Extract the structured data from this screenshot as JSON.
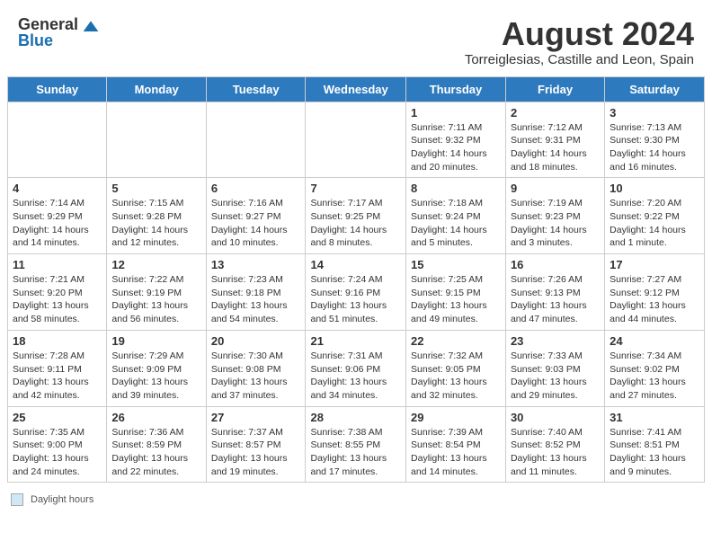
{
  "header": {
    "logo_general": "General",
    "logo_blue": "Blue",
    "month_year": "August 2024",
    "location": "Torreiglesias, Castille and Leon, Spain"
  },
  "weekdays": [
    "Sunday",
    "Monday",
    "Tuesday",
    "Wednesday",
    "Thursday",
    "Friday",
    "Saturday"
  ],
  "footer": {
    "label": "Daylight hours"
  },
  "weeks": [
    [
      {
        "day": "",
        "info": ""
      },
      {
        "day": "",
        "info": ""
      },
      {
        "day": "",
        "info": ""
      },
      {
        "day": "",
        "info": ""
      },
      {
        "day": "1",
        "info": "Sunrise: 7:11 AM\nSunset: 9:32 PM\nDaylight: 14 hours\nand 20 minutes."
      },
      {
        "day": "2",
        "info": "Sunrise: 7:12 AM\nSunset: 9:31 PM\nDaylight: 14 hours\nand 18 minutes."
      },
      {
        "day": "3",
        "info": "Sunrise: 7:13 AM\nSunset: 9:30 PM\nDaylight: 14 hours\nand 16 minutes."
      }
    ],
    [
      {
        "day": "4",
        "info": "Sunrise: 7:14 AM\nSunset: 9:29 PM\nDaylight: 14 hours\nand 14 minutes."
      },
      {
        "day": "5",
        "info": "Sunrise: 7:15 AM\nSunset: 9:28 PM\nDaylight: 14 hours\nand 12 minutes."
      },
      {
        "day": "6",
        "info": "Sunrise: 7:16 AM\nSunset: 9:27 PM\nDaylight: 14 hours\nand 10 minutes."
      },
      {
        "day": "7",
        "info": "Sunrise: 7:17 AM\nSunset: 9:25 PM\nDaylight: 14 hours\nand 8 minutes."
      },
      {
        "day": "8",
        "info": "Sunrise: 7:18 AM\nSunset: 9:24 PM\nDaylight: 14 hours\nand 5 minutes."
      },
      {
        "day": "9",
        "info": "Sunrise: 7:19 AM\nSunset: 9:23 PM\nDaylight: 14 hours\nand 3 minutes."
      },
      {
        "day": "10",
        "info": "Sunrise: 7:20 AM\nSunset: 9:22 PM\nDaylight: 14 hours\nand 1 minute."
      }
    ],
    [
      {
        "day": "11",
        "info": "Sunrise: 7:21 AM\nSunset: 9:20 PM\nDaylight: 13 hours\nand 58 minutes."
      },
      {
        "day": "12",
        "info": "Sunrise: 7:22 AM\nSunset: 9:19 PM\nDaylight: 13 hours\nand 56 minutes."
      },
      {
        "day": "13",
        "info": "Sunrise: 7:23 AM\nSunset: 9:18 PM\nDaylight: 13 hours\nand 54 minutes."
      },
      {
        "day": "14",
        "info": "Sunrise: 7:24 AM\nSunset: 9:16 PM\nDaylight: 13 hours\nand 51 minutes."
      },
      {
        "day": "15",
        "info": "Sunrise: 7:25 AM\nSunset: 9:15 PM\nDaylight: 13 hours\nand 49 minutes."
      },
      {
        "day": "16",
        "info": "Sunrise: 7:26 AM\nSunset: 9:13 PM\nDaylight: 13 hours\nand 47 minutes."
      },
      {
        "day": "17",
        "info": "Sunrise: 7:27 AM\nSunset: 9:12 PM\nDaylight: 13 hours\nand 44 minutes."
      }
    ],
    [
      {
        "day": "18",
        "info": "Sunrise: 7:28 AM\nSunset: 9:11 PM\nDaylight: 13 hours\nand 42 minutes."
      },
      {
        "day": "19",
        "info": "Sunrise: 7:29 AM\nSunset: 9:09 PM\nDaylight: 13 hours\nand 39 minutes."
      },
      {
        "day": "20",
        "info": "Sunrise: 7:30 AM\nSunset: 9:08 PM\nDaylight: 13 hours\nand 37 minutes."
      },
      {
        "day": "21",
        "info": "Sunrise: 7:31 AM\nSunset: 9:06 PM\nDaylight: 13 hours\nand 34 minutes."
      },
      {
        "day": "22",
        "info": "Sunrise: 7:32 AM\nSunset: 9:05 PM\nDaylight: 13 hours\nand 32 minutes."
      },
      {
        "day": "23",
        "info": "Sunrise: 7:33 AM\nSunset: 9:03 PM\nDaylight: 13 hours\nand 29 minutes."
      },
      {
        "day": "24",
        "info": "Sunrise: 7:34 AM\nSunset: 9:02 PM\nDaylight: 13 hours\nand 27 minutes."
      }
    ],
    [
      {
        "day": "25",
        "info": "Sunrise: 7:35 AM\nSunset: 9:00 PM\nDaylight: 13 hours\nand 24 minutes."
      },
      {
        "day": "26",
        "info": "Sunrise: 7:36 AM\nSunset: 8:59 PM\nDaylight: 13 hours\nand 22 minutes."
      },
      {
        "day": "27",
        "info": "Sunrise: 7:37 AM\nSunset: 8:57 PM\nDaylight: 13 hours\nand 19 minutes."
      },
      {
        "day": "28",
        "info": "Sunrise: 7:38 AM\nSunset: 8:55 PM\nDaylight: 13 hours\nand 17 minutes."
      },
      {
        "day": "29",
        "info": "Sunrise: 7:39 AM\nSunset: 8:54 PM\nDaylight: 13 hours\nand 14 minutes."
      },
      {
        "day": "30",
        "info": "Sunrise: 7:40 AM\nSunset: 8:52 PM\nDaylight: 13 hours\nand 11 minutes."
      },
      {
        "day": "31",
        "info": "Sunrise: 7:41 AM\nSunset: 8:51 PM\nDaylight: 13 hours\nand 9 minutes."
      }
    ]
  ]
}
